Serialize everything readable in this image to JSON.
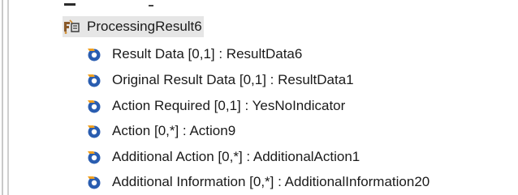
{
  "tree": {
    "parent": {
      "label": "ProcessingResult6",
      "icon": "class-element-icon"
    },
    "children": [
      {
        "label": "Result Data [0,1] : ResultData6",
        "icon": "attribute-icon"
      },
      {
        "label": "Original Result Data [0,1] : ResultData1",
        "icon": "attribute-icon"
      },
      {
        "label": "Action Required [0,1] : YesNoIndicator",
        "icon": "attribute-icon"
      },
      {
        "label": "Action [0,*] : Action9",
        "icon": "attribute-icon"
      },
      {
        "label": "Additional Action [0,*] : AdditionalAction1",
        "icon": "attribute-icon"
      },
      {
        "label": "Additional Information [0,*] : AdditionalInformation20",
        "icon": "attribute-icon"
      }
    ]
  },
  "colors": {
    "selection_bg": "#e6e6e6",
    "attribute_icon_orange": "#f0a020",
    "attribute_icon_blue": "#2a5db0"
  }
}
